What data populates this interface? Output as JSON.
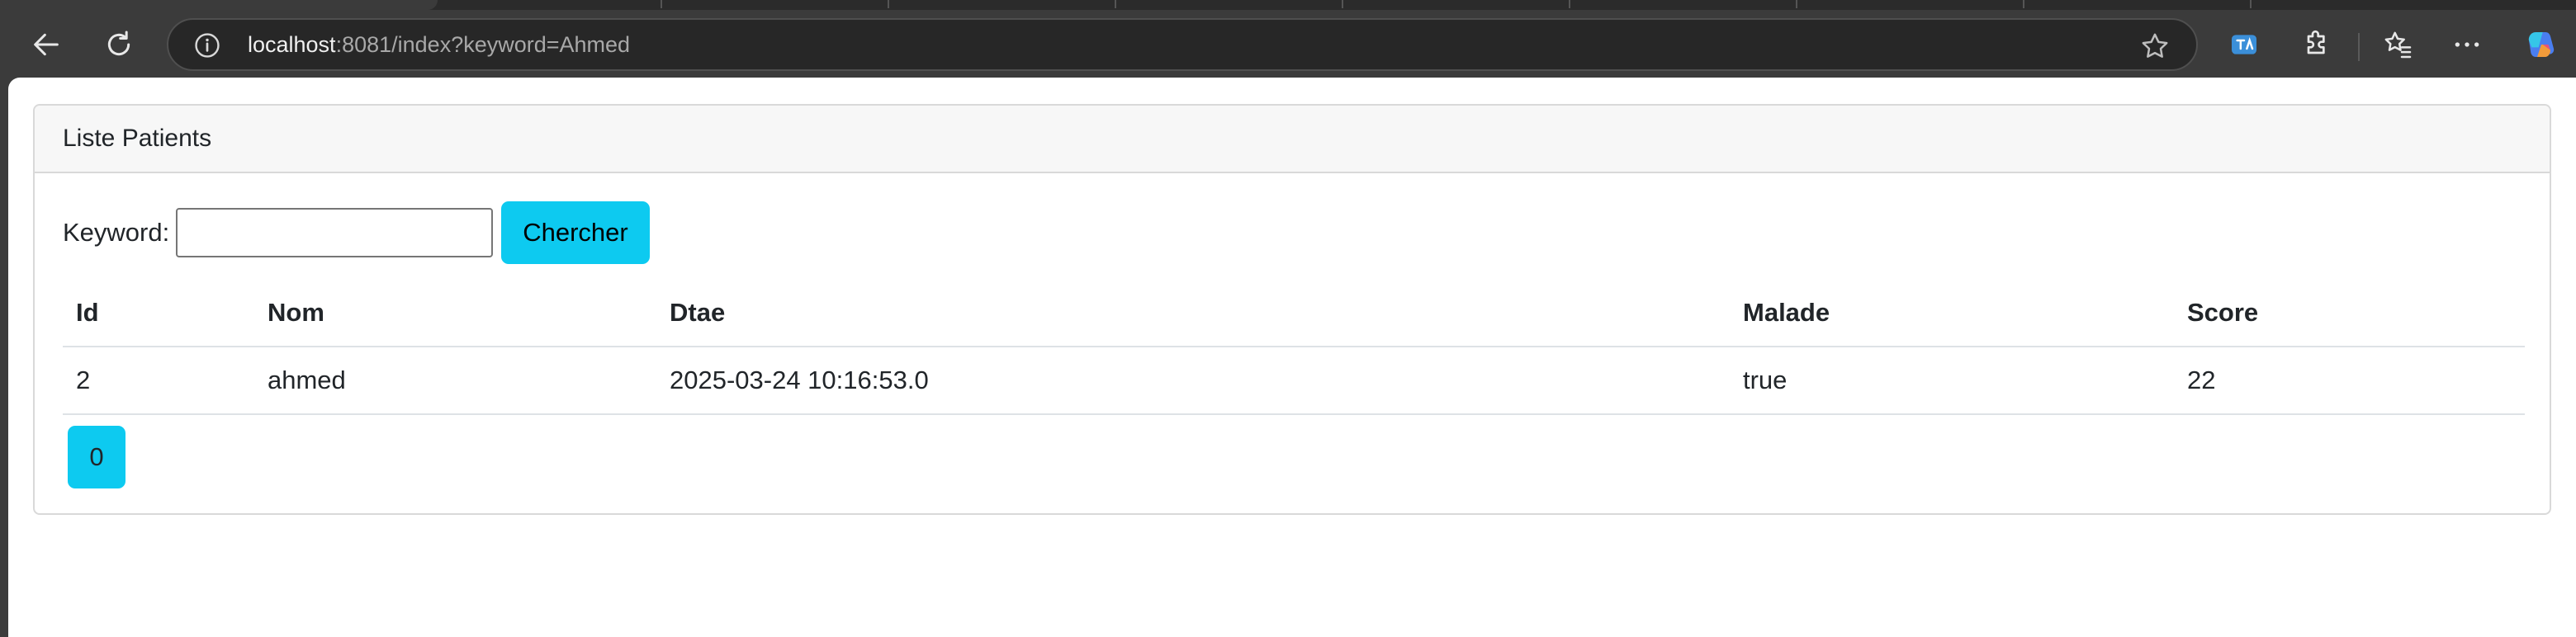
{
  "browser": {
    "url_host": "localhost",
    "url_rest": ":8081/index?keyword=Ahmed",
    "icons": {
      "back": "back-arrow-icon",
      "refresh": "refresh-icon",
      "info": "info-icon",
      "favorite": "star-icon",
      "translate": "translate-icon",
      "extensions": "puzzle-icon",
      "favorites": "favorites-icon",
      "menu": "more-icon",
      "copilot": "copilot-icon"
    }
  },
  "card": {
    "header": "Liste Patients",
    "search": {
      "label": "Keyword:",
      "value": "",
      "button": "Chercher"
    },
    "table": {
      "columns": [
        "Id",
        "Nom",
        "Dtae",
        "Malade",
        "Score"
      ],
      "rows": [
        [
          "2",
          "ahmed",
          "2025-03-24 10:16:53.0",
          "true",
          "22"
        ]
      ]
    },
    "pagination": [
      "0"
    ]
  },
  "colors": {
    "accent": "#0dcaf0",
    "chrome": "#3b3b3b",
    "omnibox": "#272727"
  }
}
